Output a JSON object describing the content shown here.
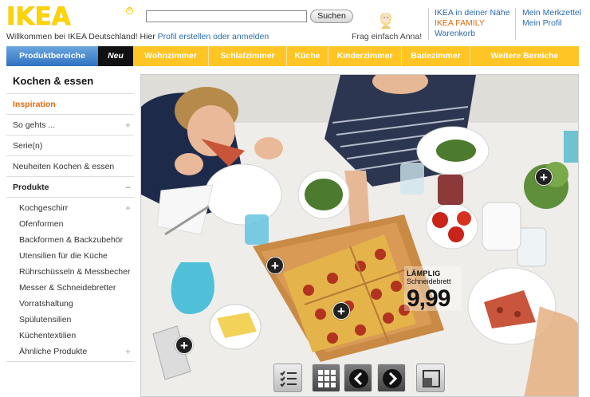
{
  "header": {
    "logo_text": "IKEA",
    "welcome_text": "Willkommen bei IKEA Deutschland! Hier",
    "welcome_link": "Profil erstellen oder anmelden",
    "search_button": "Suchen",
    "search_value": "",
    "assistant_label": "Frag einfach Anna!",
    "links_col1": [
      "IKEA in deiner Nähe",
      "IKEA FAMILY",
      "Warenkorb"
    ],
    "links_col2": [
      "Mein Merkzettel",
      "Mein Profil"
    ]
  },
  "nav": {
    "items": [
      "Produktbereiche",
      "Neu",
      "Wohnzimmer",
      "Schlafzimmer",
      "Küche",
      "Kinderzimmer",
      "Badezimmer",
      "Weitere Bereiche"
    ]
  },
  "sidebar": {
    "title": "Kochen & essen",
    "rows": [
      "Inspiration",
      "So gehts ...",
      "Serie(n)",
      "Neuheiten Kochen & essen",
      "Produkte"
    ],
    "sub_items": [
      "Kochgeschirr",
      "Ofenformen",
      "Backformen & Backzubehör",
      "Utensilien für die Küche",
      "Rührschüsseln & Messbecher",
      "Messer & Schneidebretter",
      "Vorratshaltung",
      "Spülutensilien",
      "Küchentextilien",
      "Ähnliche Produkte"
    ]
  },
  "hero": {
    "product_name": "LÄMPLIG",
    "product_desc": "Schneidebrett",
    "price": "9,99",
    "plus_symbol": "+"
  },
  "colors": {
    "brand_yellow": "#ffc524",
    "brand_blue": "#2f72c0",
    "link_blue": "#2a6bb0",
    "accent_orange": "#e06a10"
  },
  "icons": [
    "checklist-icon",
    "grid-icon",
    "arrow-left-icon",
    "arrow-right-icon",
    "window-icon"
  ]
}
